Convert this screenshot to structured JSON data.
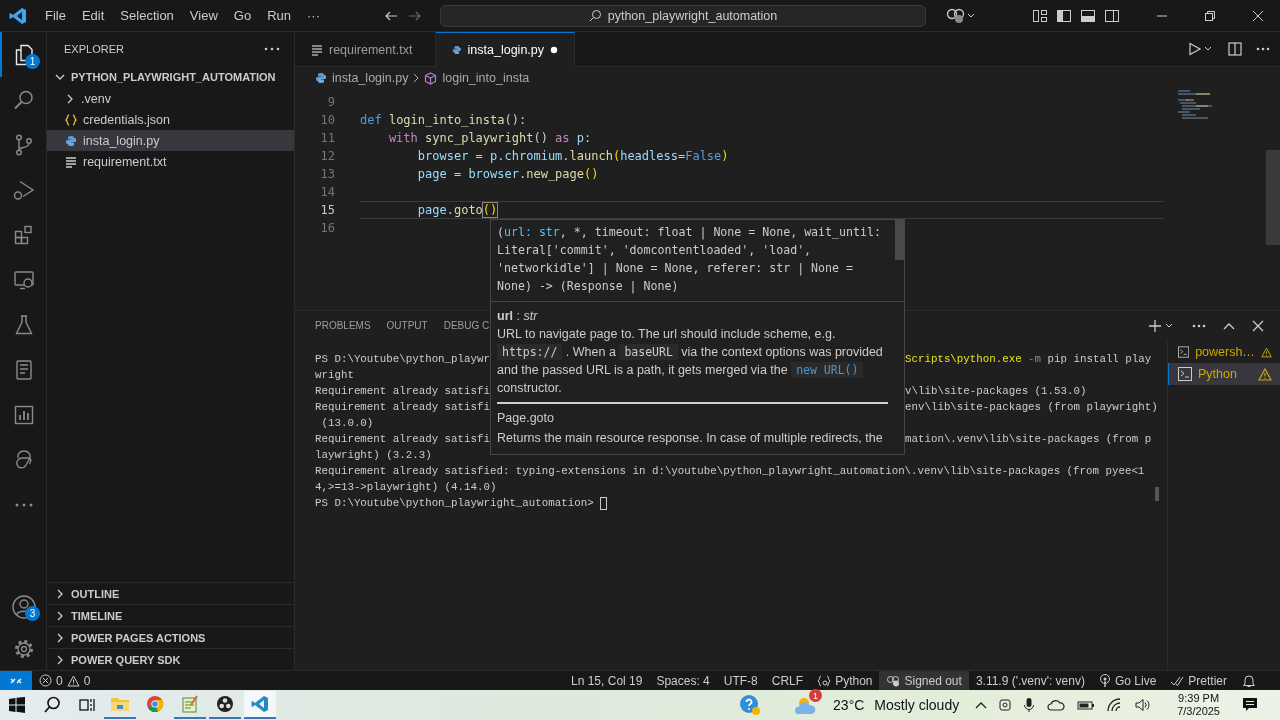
{
  "menu": [
    "File",
    "Edit",
    "Selection",
    "View",
    "Go",
    "Run",
    "···"
  ],
  "command_center": {
    "text": "python_playwright_automation"
  },
  "activity_bar": {
    "top": [
      {
        "selected": true,
        "badge": "1"
      },
      {
        "selected": false
      },
      {
        "selected": false
      },
      {
        "selected": false
      },
      {
        "selected": false
      },
      {
        "selected": false
      },
      {
        "selected": false
      },
      {
        "selected": false
      },
      {
        "selected": false
      },
      {
        "selected": false
      },
      {
        "selected": false
      }
    ],
    "account": {
      "badge": "3"
    }
  },
  "sidebar": {
    "title": "EXPLORER",
    "folder": {
      "label": "PYTHON_PLAYWRIGHT_AUTOMATION",
      "expanded": true,
      "children": [
        {
          "label": ".venv",
          "kind": "folder",
          "selected": false
        },
        {
          "label": "credentials.json",
          "kind": "json",
          "selected": false
        },
        {
          "label": "insta_login.py",
          "kind": "python",
          "selected": true
        },
        {
          "label": "requirement.txt",
          "kind": "text",
          "selected": false
        }
      ]
    },
    "sections": [
      {
        "label": "OUTLINE",
        "expanded": false
      },
      {
        "label": "TIMELINE",
        "expanded": false
      },
      {
        "label": "POWER PAGES ACTIONS",
        "expanded": false
      },
      {
        "label": "POWER QUERY SDK",
        "expanded": false
      }
    ]
  },
  "tabs": [
    {
      "label": "requirement.txt",
      "kind": "text",
      "selected": false,
      "modified": false
    },
    {
      "label": "insta_login.py",
      "kind": "python",
      "selected": true,
      "modified": true
    }
  ],
  "breadcrumb": [
    {
      "label": "insta_login.py",
      "kind": "python"
    },
    {
      "label": "login_into_insta",
      "kind": "function"
    }
  ],
  "code": {
    "lines": [
      {
        "number": "9",
        "current": false
      },
      {
        "number": "10",
        "current": false,
        "tokens": [
          {
            "text": "def ",
            "kind": "keyword"
          },
          {
            "text": "login_into_insta",
            "kind": "function"
          },
          {
            "text": "():",
            "kind": "plain"
          }
        ]
      },
      {
        "number": "11",
        "current": false,
        "tokens": [
          {
            "text": "    with ",
            "kind": "control"
          },
          {
            "text": "sync_playwright",
            "kind": "function"
          },
          {
            "text": "()",
            "kind": "plain"
          },
          {
            "text": " as ",
            "kind": "control"
          },
          {
            "text": "p",
            "kind": "variable"
          },
          {
            "text": ":",
            "kind": "plain"
          }
        ]
      },
      {
        "number": "12",
        "current": false,
        "tokens": [
          {
            "text": "        browser",
            "kind": "variable"
          },
          {
            "text": " = ",
            "kind": "plain"
          },
          {
            "text": "p",
            "kind": "variable"
          },
          {
            "text": ".",
            "kind": "plain"
          },
          {
            "text": "chromium",
            "kind": "variable"
          },
          {
            "text": ".",
            "kind": "plain"
          },
          {
            "text": "launch",
            "kind": "function"
          },
          {
            "text": "(",
            "kind": "bracket"
          },
          {
            "text": "headless",
            "kind": "variable"
          },
          {
            "text": "=",
            "kind": "plain"
          },
          {
            "text": "False",
            "kind": "keyword"
          },
          {
            "text": ")",
            "kind": "bracket"
          }
        ]
      },
      {
        "number": "13",
        "current": false,
        "tokens": [
          {
            "text": "        page",
            "kind": "variable"
          },
          {
            "text": " = ",
            "kind": "plain"
          },
          {
            "text": "browser",
            "kind": "variable"
          },
          {
            "text": ".",
            "kind": "plain"
          },
          {
            "text": "new_page",
            "kind": "function"
          },
          {
            "text": "()",
            "kind": "bracket"
          }
        ]
      },
      {
        "number": "14",
        "current": false
      },
      {
        "number": "15",
        "current": true,
        "tokens": [
          {
            "text": "        page",
            "kind": "variable"
          },
          {
            "text": ".",
            "kind": "plain"
          },
          {
            "text": "goto",
            "kind": "function"
          },
          {
            "text": "()",
            "kind": "bracket-match"
          }
        ]
      },
      {
        "number": "16",
        "current": false
      }
    ]
  },
  "hover": {
    "signature": [
      [
        {
          "text": "(",
          "active": false
        },
        {
          "text": "url: str",
          "active": true
        },
        {
          "text": ", *, timeout: float | None = None, wait_until:",
          "active": false
        }
      ],
      [
        {
          "text": "Literal['commit', 'domcontentloaded', 'load',",
          "active": false
        }
      ],
      [
        {
          "text": "'networkidle'] | None = None, referer: str | None =",
          "active": false
        }
      ],
      [
        {
          "text": "None) -> (Response | None)",
          "active": false
        }
      ]
    ],
    "param": "**url** : *str*",
    "description": [
      {
        "text": "URL to navigate page to. The url should include scheme, e.g. ",
        "kind": "text"
      },
      {
        "text": "https://",
        "kind": "code"
      },
      {
        "text": " . When a ",
        "kind": "text"
      },
      {
        "text": "baseURL",
        "kind": "code"
      },
      {
        "text": " via the context options was provided and the passed URL is a path, it gets merged via the ",
        "kind": "text"
      },
      {
        "text": "new URL()",
        "kind": "link"
      },
      {
        "text": " constructor.",
        "kind": "text"
      }
    ],
    "title": "Page.goto",
    "more": "Returns the main resource response. In case of multiple redirects, the"
  },
  "panel": {
    "tabs": [
      {
        "label": "PROBLEMS",
        "selected": false
      },
      {
        "label": "OUTPUT",
        "selected": false
      },
      {
        "label": "DEBUG C",
        "selected": false
      }
    ],
    "terminal": [
      {
        "left": "PS D:\\Youtube\\python_playwr",
        "right": [
          {
            "text": "Scripts\\python.exe",
            "kind": "command"
          },
          {
            "text": " -m",
            "kind": "flag"
          },
          {
            "text": " pip install play",
            "kind": "plain"
          }
        ]
      },
      {
        "left": "wright"
      },
      {
        "left": "Requirement already satisfi",
        "right": [
          {
            "text": "v\\lib\\site-packages (1.53.0)",
            "kind": "plain"
          }
        ]
      },
      {
        "left": "Requirement already satisfi",
        "right": [
          {
            "text": "env\\lib\\site-packages (from playwright)",
            "kind": "plain"
          }
        ]
      },
      {
        "left": " (13.0.0)"
      },
      {
        "left": "Requirement already satisfi",
        "right": [
          {
            "text": "mation\\.venv\\lib\\site-packages (from p",
            "kind": "plain"
          }
        ]
      },
      {
        "left": "laywright) (3.2.3)"
      },
      {
        "left": "Requirement already satisfied: typing-extensions in d:\\youtube\\python_playwright_automation\\.venv\\lib\\site-packages (from pyee<1"
      },
      {
        "left": "4,>=13->playwright) (4.14.0)"
      }
    ],
    "prompt": "PS D:\\Youtube\\python_playwright_automation> ",
    "terminals": [
      {
        "label": "powersh…",
        "selected": false,
        "warning": true
      },
      {
        "label": "Python",
        "selected": true,
        "warning": true
      }
    ]
  },
  "status_bar": {
    "errors": "0",
    "warnings": "0",
    "items": [
      {
        "text": "Ln 15, Col 19",
        "kind": "plain",
        "highlighted": false
      },
      {
        "text": "Spaces: 4",
        "kind": "plain",
        "highlighted": false
      },
      {
        "text": "UTF-8",
        "kind": "plain",
        "highlighted": false
      },
      {
        "text": "CRLF",
        "kind": "plain",
        "highlighted": false
      },
      {
        "text": "Python",
        "kind": "language",
        "highlighted": false
      },
      {
        "text": "Signed out",
        "kind": "account",
        "highlighted": true
      },
      {
        "text": "3.11.9 ('.venv': venv)",
        "kind": "plain",
        "highlighted": false
      },
      {
        "text": "Go Live",
        "kind": "live",
        "highlighted": false
      },
      {
        "text": "Prettier",
        "kind": "prettier",
        "highlighted": false
      }
    ]
  },
  "taskbar": {
    "apps": [
      {
        "running": true,
        "active": false
      },
      {
        "running": false,
        "active": false
      },
      {
        "running": true,
        "active": false
      },
      {
        "running": true,
        "active": false
      },
      {
        "running": true,
        "active": true
      }
    ],
    "weather": {
      "alert": "1",
      "temperature": "23°C",
      "condition": "Mostly cloudy"
    },
    "time": "9:39 PM",
    "date": "7/3/2025"
  }
}
